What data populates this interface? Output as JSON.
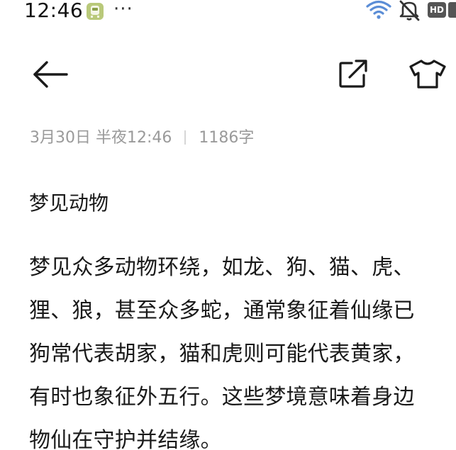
{
  "status_bar": {
    "time": "12:46",
    "more_indicator": "···",
    "hd_label": "HD",
    "icons": [
      "app-notification-icon",
      "wifi-icon",
      "mute-icon",
      "hd-icon"
    ]
  },
  "toolbar": {
    "back_icon": "arrow-left-icon",
    "share_icon": "share-export-icon",
    "theme_icon": "tshirt-theme-icon"
  },
  "note": {
    "date": "3月30日 半夜12:46",
    "word_count": "1186字",
    "title": "梦见动物",
    "body_lines": [
      "梦见众多动物环绕，如龙、狗、猫、虎、",
      "狸、狼，甚至众多蛇，通常象征着仙缘已",
      "狗常代表胡家，猫和虎则可能代表黄家，",
      "有时也象征外五行。这些梦境意味着身边",
      "物仙在守护并结缘。"
    ]
  }
}
